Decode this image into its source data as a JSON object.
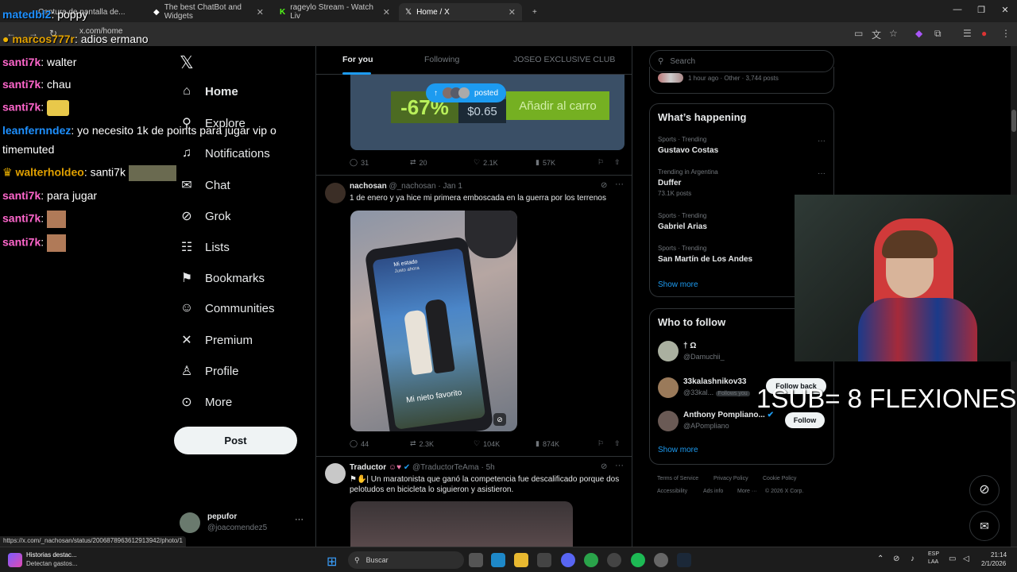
{
  "browser": {
    "tabs": [
      {
        "label": "Captura de pantalla de..."
      },
      {
        "label": "The best ChatBot and Widgets"
      },
      {
        "label": "rageylo Stream - Watch Liv"
      },
      {
        "label": "Home / X"
      }
    ],
    "url": "x.com/home",
    "status_url": "https://x.com/_nachosan/status/2006878963612913942/photo/1"
  },
  "nav": {
    "items": [
      {
        "label": "Home",
        "icon": "home-icon"
      },
      {
        "label": "Explore",
        "icon": "search-icon"
      },
      {
        "label": "Notifications",
        "icon": "bell-icon"
      },
      {
        "label": "Chat",
        "icon": "mail-icon"
      },
      {
        "label": "Grok",
        "icon": "grok-icon"
      },
      {
        "label": "Lists",
        "icon": "list-icon"
      },
      {
        "label": "Bookmarks",
        "icon": "bookmark-icon"
      },
      {
        "label": "Communities",
        "icon": "people-icon"
      },
      {
        "label": "Premium",
        "icon": "x-icon"
      },
      {
        "label": "Profile",
        "icon": "person-icon"
      },
      {
        "label": "More",
        "icon": "more-icon"
      }
    ],
    "post_label": "Post",
    "account": {
      "name": "pepufor",
      "handle": "@joacomendez5"
    }
  },
  "feed": {
    "tabs": [
      "For you",
      "Following",
      "JOSEO EXCLUSIVE CLUB"
    ],
    "posted_pill": "posted",
    "ad": {
      "discount": "-67%",
      "price": "$0.65",
      "cta": "Añadir al carro"
    },
    "tweets": [
      {
        "actions": {
          "replies": "31",
          "retweets": "20",
          "likes": "2.1K",
          "views": "57K"
        }
      },
      {
        "name": "nachosan",
        "handle": "@_nachosan",
        "time": "Jan 1",
        "text": "1 de enero y ya hice mi primera emboscada en la guerra por los terrenos",
        "image_caption": "Mi nieto favorito",
        "image_header": "Mi estado",
        "image_sub": "Justo ahora",
        "actions": {
          "replies": "44",
          "retweets": "2.3K",
          "likes": "104K",
          "views": "874K"
        }
      },
      {
        "name": "Traductor",
        "handle": "@TraductorTeAma",
        "time": "5h",
        "text": "| Un maratonista que ganó la competencia fue descalificado porque dos pelotudos en bicicleta lo siguieron y asistieron."
      }
    ]
  },
  "sidebar": {
    "search_placeholder": "Search",
    "top_meta": "1 hour ago · Other · 3,744 posts",
    "happening_title": "What’s happening",
    "trends": [
      {
        "category": "Sports · Trending",
        "name": "Gustavo Costas",
        "count": ""
      },
      {
        "category": "Trending in Argentina",
        "name": "Duffer",
        "count": "73.1K posts"
      },
      {
        "category": "Sports · Trending",
        "name": "Gabriel Arias",
        "count": ""
      },
      {
        "category": "Sports · Trending",
        "name": "San Martín de Los Andes",
        "count": ""
      }
    ],
    "show_more": "Show more",
    "wtf_title": "Who to follow",
    "wtf": [
      {
        "name": "† Ω",
        "handle": "@Damuchii_",
        "button": ""
      },
      {
        "name": "33kalashnikov33",
        "handle": "@33kal...",
        "badge": "Follows you",
        "button": "Follow back"
      },
      {
        "name": "Anthony Pompliano...",
        "handle": "@APompliano",
        "button": "Follow"
      }
    ],
    "footer": [
      "Terms of Service",
      "Privacy Policy",
      "Cookie Policy",
      "Accessibility",
      "Ads info",
      "More ···",
      "© 2026 X Corp."
    ]
  },
  "stream_chat": [
    {
      "user": "matedbl2",
      "msg": ": poppy"
    },
    {
      "user": "marcos777r",
      "msg": ": adios ermano"
    },
    {
      "user": "santi7k",
      "msg": ": walter"
    },
    {
      "user": "santi7k",
      "msg": ": chau"
    },
    {
      "user": "santi7k",
      "msg": ":"
    },
    {
      "user": "leanfernndez",
      "msg": ": yo necesito 1k de points para jugar vip o"
    },
    {
      "user": "",
      "msg": "timemuted"
    },
    {
      "user": "walterholdeo",
      "msg": ": santi7k"
    },
    {
      "user": "santi7k",
      "msg": ": para jugar"
    },
    {
      "user": "santi7k",
      "msg": ":"
    },
    {
      "user": "santi7k",
      "msg": ":"
    }
  ],
  "stream_overlay": "1SUB= 8 FLEXIONES",
  "taskbar": {
    "notif_title": "Historias destac...",
    "notif_sub": "Detectan gastos...",
    "search_label": "Buscar",
    "lang_top": "ESP",
    "lang_bottom": "LAA",
    "time": "21:14",
    "date": "2/1/2026"
  },
  "colors": {
    "accent": "#1d9bf0",
    "steam_green": "#75b022",
    "chat_user": "#1e90ff"
  }
}
